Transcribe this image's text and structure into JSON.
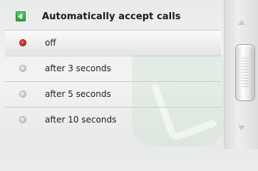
{
  "header": {
    "title": "Automatically accept calls",
    "back_icon": "back-arrow-icon",
    "accent_color": "#2aa13a"
  },
  "options": [
    {
      "label": "off",
      "selected": true
    },
    {
      "label": "after 3 seconds",
      "selected": false
    },
    {
      "label": "after 5 seconds",
      "selected": false
    },
    {
      "label": "after 10 seconds",
      "selected": false
    }
  ],
  "scrollbar": {
    "up_icon": "scroll-up-arrow-icon",
    "down_icon": "scroll-down-arrow-icon"
  },
  "background_icon": "phone-icon"
}
